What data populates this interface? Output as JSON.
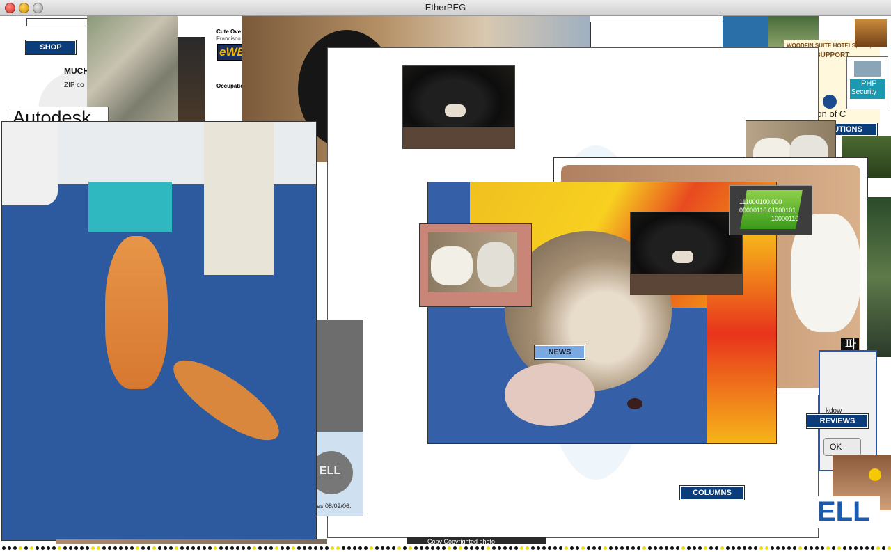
{
  "window": {
    "title": "EtherPEG"
  },
  "labels": {
    "shop": "SHOP",
    "much": "MUCH",
    "zip": "ZIP co",
    "autodesk": "Autodesk",
    "cute_over": "Cute Ove",
    "francisco": "Francisco",
    "eweek": "eWEEK",
    "occupation": "Occupatio",
    "woodfin": "WOODFIN SUITE HOTELS, LLC,",
    "support": "SUPPORT",
    "sion": "sion of C",
    "utions": "UTIONS",
    "php": "PHP",
    "security": "Security",
    "news": "NEWS",
    "reviews": "REVIEWS",
    "columns": "COLUMNS",
    "ok": "OK",
    "dell_date": "es 08/02/06.",
    "dell_logo": "ELL",
    "dell_big": "ELL",
    "binary1": "111000100.000",
    "binary2": "00000110 01100101",
    "binary3": "10000110",
    "korean": "파란샬",
    "kdow": "kdow",
    "copyright": "Copy Copyrighted photo"
  },
  "colors": {
    "nav_blue": "#0b3d7a",
    "news_blue": "#7aa8e0",
    "tile_blue": "#2d5a9e",
    "cat_orange": "#e0893a"
  }
}
